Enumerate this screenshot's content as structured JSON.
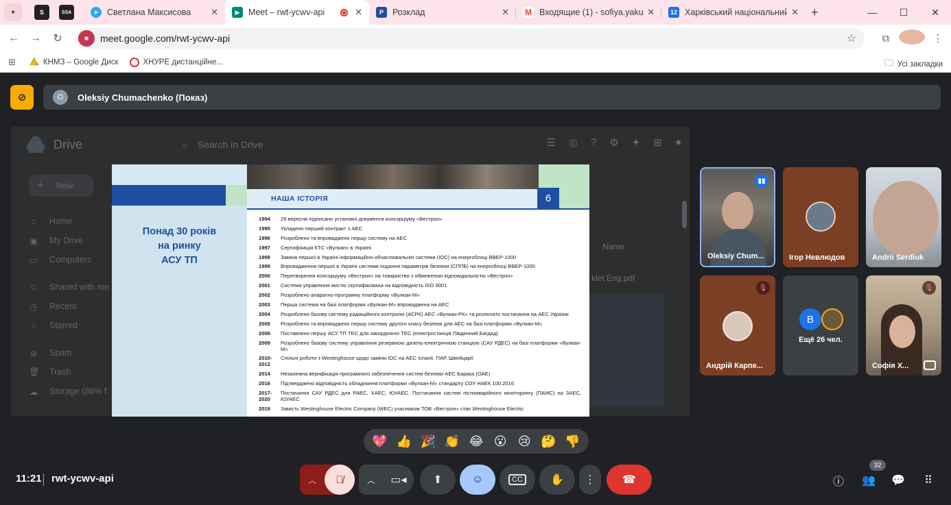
{
  "browser": {
    "tabs": [
      {
        "title": "Светлана Максисова",
        "favicon_color": "#2aabee"
      },
      {
        "title": "Meet – rwt-ycwv-api",
        "favicon_color": "#00897b",
        "active": true
      },
      {
        "title": "Розклад",
        "favicon_color": "#1f4fa5"
      },
      {
        "title": "Входящие (1) - sofiya.yakubov",
        "favicon_color": "#ea4335"
      },
      {
        "title": "Харківський національний ун",
        "favicon_color": "#1a73e8"
      }
    ],
    "pinned": [
      "S",
      "SSA"
    ],
    "url": "meet.google.com/rwt-ycwv-api",
    "bookmarks": [
      "КНМЗ – Google Диск",
      "ХНУРЕ дистанційне..."
    ],
    "all_bookmarks": "Усі закладки"
  },
  "presenter": {
    "initial": "O",
    "label": "Oleksiy Chumachenko (Показ)"
  },
  "shared_screen": {
    "drive": {
      "app_name": "Drive",
      "search_placeholder": "Search in Drive",
      "new_label": "New",
      "nav": [
        "Home",
        "My Drive",
        "Computers",
        "Shared with me",
        "Recent",
        "Starred",
        "Spam",
        "Trash",
        "Storage (86% f"
      ],
      "column_name": "Name",
      "file_name": "klet Eng.pdf"
    },
    "slide": {
      "left_heading": [
        "Понад 30 років",
        "на ринку",
        "АСУ ТП"
      ],
      "section_title": "НАША ІСТОРІЯ",
      "page_number": "6",
      "timeline": [
        {
          "year": "1994",
          "text": "29 вересня підписано установчі документи консорціуму «Вестрон»"
        },
        {
          "year": "1995",
          "text": "Укладено перший контракт з АЕС"
        },
        {
          "year": "1996",
          "text": "Розроблено та впроваджено першу систему на АЕС"
        },
        {
          "year": "1997",
          "text": "Сертифікація КТС «Вулкан» в Україні"
        },
        {
          "year": "1998",
          "text": "Заміна першої в Україні інформаційно-обчислювальної системи (ІОС) на енергоблоці ВВЕР-1000"
        },
        {
          "year": "1999",
          "text": "Впровадження першої в Україні системи подання параметрів безпеки (СППБ) на енергоблоці ВВЕР-1000"
        },
        {
          "year": "2000",
          "text": "Перетворення консорціуму «Вестрон» на товариство з обмеженою відповідальністю «Вестрон»"
        },
        {
          "year": "2001",
          "text": "Система управління якістю сертифікована на відповідність ISO 9001"
        },
        {
          "year": "2002",
          "text": "Розроблено апаратно-програмну платформу «Вулкан-М»"
        },
        {
          "year": "2003",
          "text": "Перша система на базі платформи «Вулкан-М» впроваджена на АЕС"
        },
        {
          "year": "2004",
          "text": "Розроблено базову систему радіаційного контролю (АСРК) АЕС «Вулкан-РК» та розпочато постачання на АЕС України"
        },
        {
          "year": "2005",
          "text": "Розроблено та впроваджено першу систему другого класу безпеки для АЕС на базі платформи «Вулкан-М»"
        },
        {
          "year": "2006",
          "text": "Поставлено першу АСУ ТП ТЕС для закордонної ТЕС (електростанція Південний Багдад)"
        },
        {
          "year": "2009",
          "text": "Розроблено базову систему управління резервною дизель-електричною станцією (САУ РДЕС) на базі платформи «Вулкан-М»"
        },
        {
          "year": "2010-2013",
          "text": "Спільні роботи з Westinghouse щодо заміни ІОС на АЕС Іспанії, ПАР, Швейцарії"
        },
        {
          "year": "2014",
          "text": "Незалежна верифікація програмного забезпечення систем безпеки АЕС Баракa (ОАЕ)"
        },
        {
          "year": "2016",
          "text": "Підтверджено відповідність обладнання платформи «Вулкан-М» стандарту СОУ НАЕК 100:2016"
        },
        {
          "year": "2017-2020",
          "text": "Постачання САУ РДЕС для РАЕС, ХАЕС, ЮУАЕС. Постачання систем післяаварійного моніторингу (ПАМС) на ЗАЕС, ЮУАЕС"
        },
        {
          "year": "2019",
          "text": "Замість Westinghouse Electric Company (WEC) учасником ТОВ «Вестрон» стає Westinghouse Electric"
        }
      ]
    }
  },
  "participants": [
    {
      "name": "Oleksiy Chum...",
      "speaking": true
    },
    {
      "name": "Ігор Невлюдов"
    },
    {
      "name": "Andrii Serdiuk"
    },
    {
      "name": "Андрій Карпе...",
      "muted": true
    },
    {
      "more_label": "Ещё 26 чел.",
      "more_initial": "B"
    },
    {
      "name": "Софія Х...",
      "muted": true
    }
  ],
  "reactions": [
    "💖",
    "👍",
    "🎉",
    "👏",
    "😂",
    "😮",
    "😢",
    "🤔",
    "👎"
  ],
  "footer": {
    "time": "11:21",
    "meeting_code": "rwt-ycwv-api",
    "participant_count": "32"
  }
}
